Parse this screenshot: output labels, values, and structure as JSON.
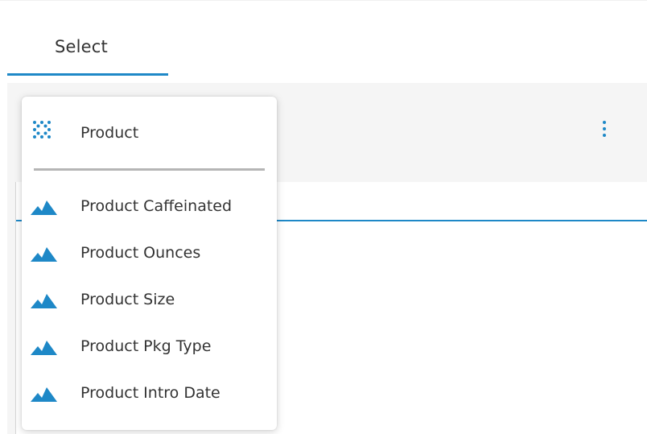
{
  "tab": {
    "label": "Select"
  },
  "dropdown": {
    "header": {
      "label": "Product",
      "icon": "dimension-grid-icon"
    },
    "items": [
      {
        "label": "Product Caffeinated",
        "icon": "attribute-mountain-icon"
      },
      {
        "label": "Product Ounces",
        "icon": "attribute-mountain-icon"
      },
      {
        "label": "Product Size",
        "icon": "attribute-mountain-icon"
      },
      {
        "label": "Product Pkg Type",
        "icon": "attribute-mountain-icon"
      },
      {
        "label": "Product Intro Date",
        "icon": "attribute-mountain-icon"
      }
    ]
  },
  "colors": {
    "accent": "#1e88c7",
    "text": "#333333",
    "divider": "#b5b5b5",
    "background": "#f5f5f5"
  }
}
